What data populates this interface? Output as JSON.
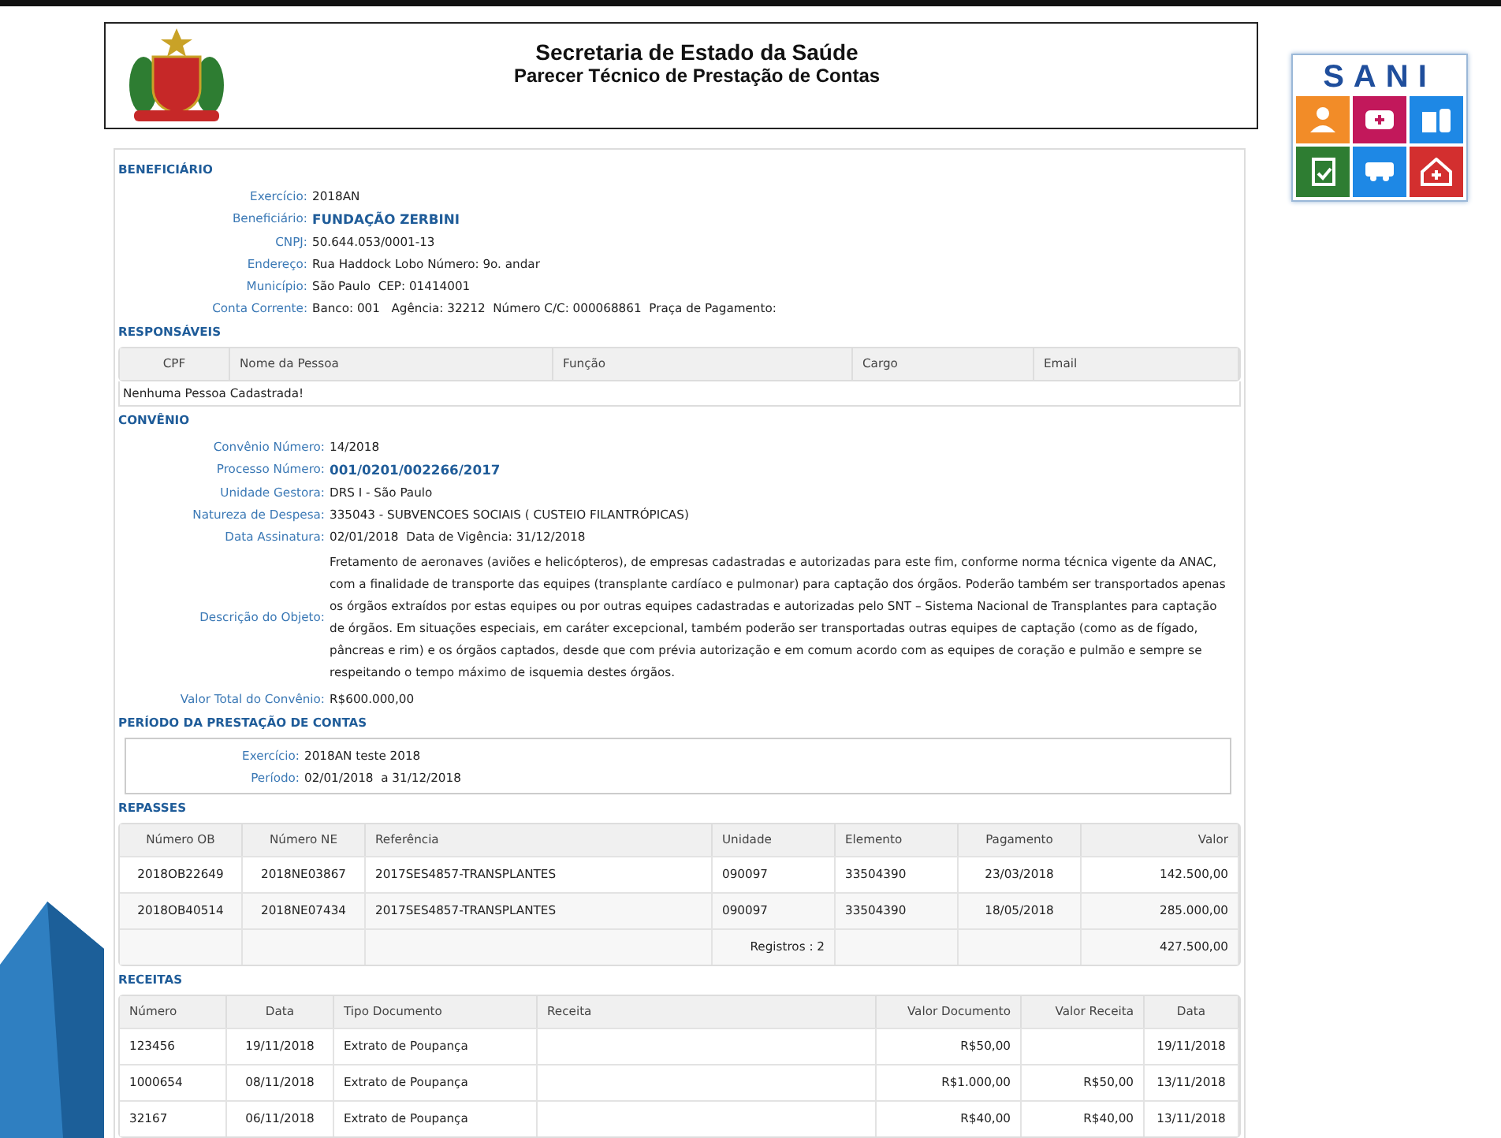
{
  "header": {
    "title": "Secretaria de Estado da Saúde",
    "subtitle": "Parecer Técnico de Prestação de Contas"
  },
  "side_logo": {
    "letters": "SANI"
  },
  "beneficiario": {
    "heading": "BENEFICIÁRIO",
    "fields": [
      {
        "label": "Exercício:",
        "value": "2018AN",
        "kind": "plain"
      },
      {
        "label": "Beneficiário:",
        "value": "FUNDAÇÃO ZERBINI",
        "kind": "highlight"
      },
      {
        "label": "CNPJ:",
        "value": "50.644.053/0001-13",
        "kind": "plain"
      },
      {
        "label": "Endereço:",
        "value": "Rua Haddock Lobo Número: 9o. andar",
        "kind": "plain"
      },
      {
        "label": "Município:",
        "value": "São Paulo  CEP: 01414001",
        "kind": "plain"
      },
      {
        "label": "Conta Corrente:",
        "value": "Banco: 001   Agência: 32212  Número C/C: 000068861  Praça de Pagamento:",
        "kind": "plain"
      }
    ]
  },
  "responsaveis": {
    "heading": "RESPONSÁVEIS",
    "columns": [
      "CPF",
      "Nome da Pessoa",
      "Função",
      "Cargo",
      "Email"
    ],
    "empty_message": "Nenhuma Pessoa Cadastrada!"
  },
  "convenio": {
    "heading": "CONVÊNIO",
    "fields": [
      {
        "label": "Convênio Número:",
        "value": "14/2018",
        "kind": "plain"
      },
      {
        "label": "Processo Número:",
        "value": "001/0201/002266/2017",
        "kind": "highlight"
      },
      {
        "label": "Unidade Gestora:",
        "value": "DRS I - São Paulo",
        "kind": "plain"
      },
      {
        "label": "Natureza de Despesa:",
        "value": "335043 - SUBVENCOES SOCIAIS ( CUSTEIO FILANTRÓPICAS)",
        "kind": "plain"
      },
      {
        "label": "Data Assinatura:",
        "value": "02/01/2018  Data de Vigência: 31/12/2018",
        "kind": "plain"
      },
      {
        "label": "Descrição do Objeto:",
        "value": "Fretamento de aeronaves (aviões e helicópteros), de empresas cadastradas e autorizadas para este fim, conforme norma técnica vigente da ANAC, com a finalidade de transporte das equipes (transplante cardíaco e pulmonar) para captação dos órgãos. Poderão também ser transportados apenas os órgãos extraídos por estas equipes ou por outras equipes cadastradas e autorizadas pelo SNT – Sistema Nacional de Transplantes para captação de órgãos. Em situações especiais, em caráter excepcional, também poderão ser transportadas outras equipes de captação (como as de fígado, pâncreas e rim) e os órgãos captados, desde que com prévia autorização e em comum acordo com as equipes de coração e pulmão e sempre se respeitando o tempo máximo de isquemia destes órgãos.",
        "kind": "paragraph"
      },
      {
        "label": "Valor Total do Convênio:",
        "value": "R$600.000,00",
        "kind": "plain"
      }
    ]
  },
  "periodo": {
    "heading": "PERÍODO DA PRESTAÇÃO DE CONTAS",
    "fields": [
      {
        "label": "Exercício:",
        "value": "2018AN teste 2018",
        "kind": "plain"
      },
      {
        "label": "Período:",
        "value": "02/01/2018  a 31/12/2018",
        "kind": "plain"
      }
    ]
  },
  "repasses": {
    "heading": "REPASSES",
    "columns": [
      "Número OB",
      "Número NE",
      "Referência",
      "Unidade",
      "Elemento",
      "Pagamento",
      "Valor"
    ],
    "rows": [
      [
        "2018OB22649",
        "2018NE03867",
        "2017SES4857-TRANSPLANTES",
        "090097",
        "33504390",
        "23/03/2018",
        "142.500,00"
      ],
      [
        "2018OB40514",
        "2018NE07434",
        "2017SES4857-TRANSPLANTES",
        "090097",
        "33504390",
        "18/05/2018",
        "285.000,00"
      ]
    ],
    "footer": {
      "count": "Registros : 2",
      "total": "427.500,00"
    }
  },
  "receitas": {
    "heading": "RECEITAS",
    "columns": [
      "Número",
      "Data",
      "Tipo Documento",
      "Receita",
      "Valor Documento",
      "Valor Receita",
      "Data"
    ],
    "rows": [
      [
        "123456",
        "19/11/2018",
        "Extrato de Poupança",
        null,
        "R$50,00",
        null,
        "19/11/2018"
      ],
      [
        "1000654",
        "08/11/2018",
        "Extrato de Poupança",
        null,
        "R$1.000,00",
        "R$50,00",
        "13/11/2018"
      ],
      [
        "32167",
        "06/11/2018",
        "Extrato de Poupança",
        null,
        "R$40,00",
        "R$40,00",
        "13/11/2018"
      ]
    ]
  }
}
